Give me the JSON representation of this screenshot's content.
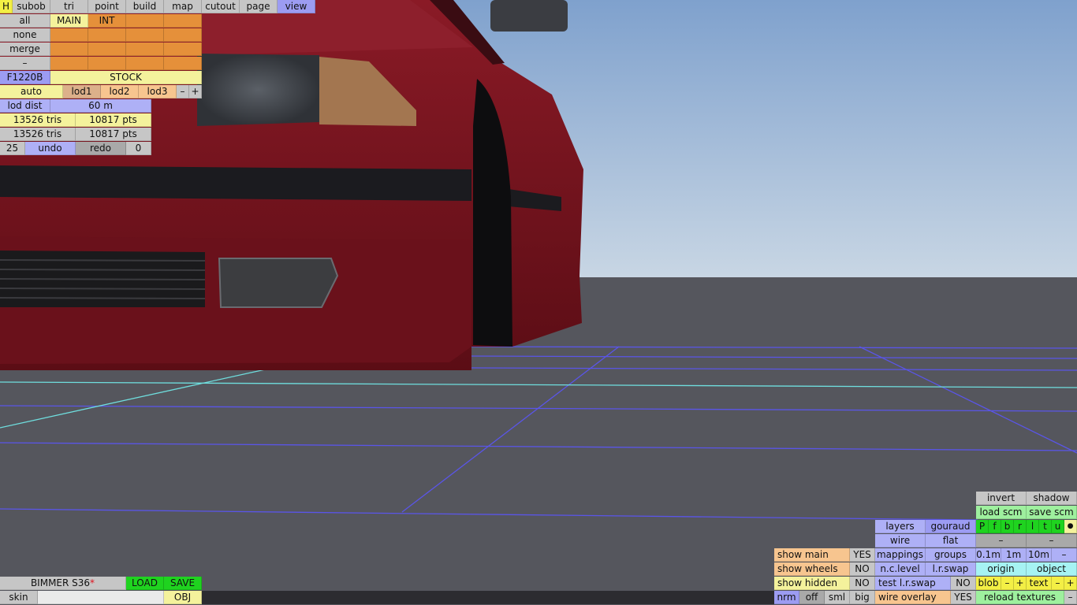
{
  "menu": [
    "H",
    "subob",
    "tri",
    "point",
    "build",
    "map",
    "cutout",
    "page",
    "view"
  ],
  "subob": {
    "buttons": [
      "all",
      "none",
      "merge",
      "–"
    ],
    "tabs": [
      "MAIN",
      "INT"
    ]
  },
  "car": {
    "code": "F1220B",
    "name": "STOCK"
  },
  "lod": {
    "auto": "auto",
    "items": [
      "lod1",
      "lod2",
      "lod3"
    ],
    "minus": "–",
    "plus": "+",
    "dist_label": "lod dist",
    "dist_value": "60 m"
  },
  "stats": [
    {
      "tris": "13526 tris",
      "pts": "10817 pts"
    },
    {
      "tris": "13526 tris",
      "pts": "10817 pts"
    }
  ],
  "history": {
    "count": "25",
    "undo": "undo",
    "redo": "redo",
    "index": "0"
  },
  "file": {
    "name": "BIMMER S36",
    "modified_mark": "*",
    "load": "LOAD",
    "save": "SAVE",
    "skin": "skin",
    "obj": "OBJ"
  },
  "right_panel": {
    "invert": "invert",
    "shadow": "shadow",
    "load_scm": "load scm",
    "save_scm": "save scm",
    "flags": [
      "P",
      "f",
      "b",
      "r",
      "l",
      "t",
      "u"
    ],
    "dot": "●",
    "dash": "–",
    "layers": "layers",
    "gouraud": "gouraud",
    "wire": "wire",
    "flat": "flat",
    "show_main": "show main",
    "show_main_val": "YES",
    "mappings": "mappings",
    "groups": "groups",
    "steps": [
      "0.1m",
      "1m",
      "10m"
    ],
    "show_wheels": "show wheels",
    "show_wheels_val": "NO",
    "nc_level": "n.c.level",
    "lr_swap": "l.r.swap",
    "origin": "origin",
    "object": "object",
    "show_hidden": "show hidden",
    "show_hidden_val": "NO",
    "test_lr_swap": "test l.r.swap",
    "test_lr_swap_val": "NO",
    "blob": "blob",
    "text": "text",
    "view_modes": [
      "nrm",
      "off",
      "sml",
      "big"
    ],
    "wire_overlay": "wire overlay",
    "wire_overlay_val": "YES",
    "reload_textures": "reload textures"
  },
  "colors": {
    "sky_top": "#7fa2ce",
    "sky_bottom": "#c6d5e3",
    "ground": "#55565d",
    "car_body": "#7a1320",
    "grid": "#5a55e8",
    "grid_axis": "#6fdede"
  }
}
